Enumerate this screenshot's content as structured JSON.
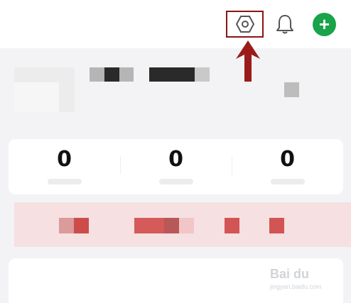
{
  "header": {
    "settings_icon": "hexagon-gear-icon",
    "bell_icon": "bell-icon",
    "add_label": "+",
    "accent_color": "#1aa34a",
    "highlight_color": "#8b1414"
  },
  "stats": [
    {
      "value": "0"
    },
    {
      "value": "0"
    },
    {
      "value": "0"
    }
  ],
  "watermark": {
    "text": "Bai du",
    "sub": "jingyan.baidu.com"
  }
}
